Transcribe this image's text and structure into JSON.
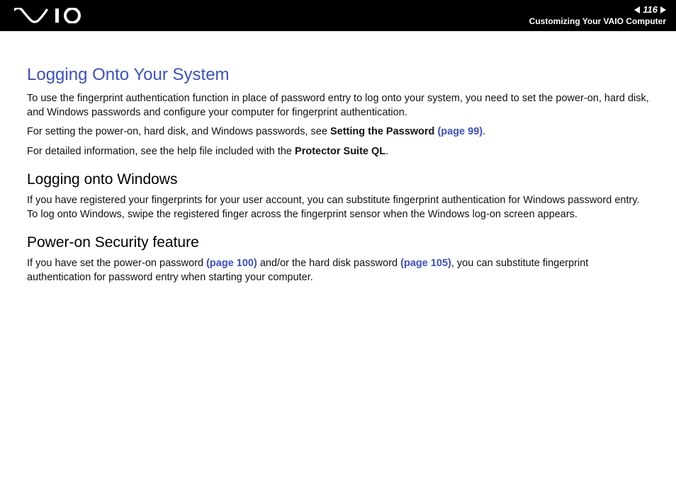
{
  "header": {
    "page_number": "116",
    "section": "Customizing Your VAIO Computer"
  },
  "main": {
    "title": "Logging Onto Your System",
    "p1": "To use the fingerprint authentication function in place of password entry to log onto your system, you need to set the power-on, hard disk, and Windows passwords and configure your computer for fingerprint authentication.",
    "p2_a": "For setting the power-on, hard disk, and Windows passwords, see ",
    "p2_bold": "Setting the Password ",
    "p2_link": "(page 99)",
    "p2_c": ".",
    "p3_a": "For detailed information, see the help file included with the ",
    "p3_bold": "Protector Suite QL",
    "p3_c": ".",
    "sub1": "Logging onto Windows",
    "p4": "If you have registered your fingerprints for your user account, you can substitute fingerprint authentication for Windows password entry. To log onto Windows, swipe the registered finger across the fingerprint sensor when the Windows log-on screen appears.",
    "sub2": "Power-on Security feature",
    "p5_a": "If you have set the power-on password ",
    "p5_link1": "(page 100)",
    "p5_b": " and/or the hard disk password ",
    "p5_link2": "(page 105)",
    "p5_c": ", you can substitute fingerprint authentication for password entry when starting your computer."
  }
}
